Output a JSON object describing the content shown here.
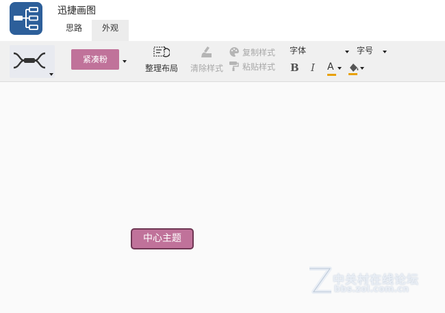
{
  "app": {
    "title": "迅捷画图",
    "logo_icon": "mindmap-logo-icon"
  },
  "tabs": [
    {
      "label": "思路",
      "active": false
    },
    {
      "label": "外观",
      "active": true
    }
  ],
  "toolbar": {
    "layout_icon": "mindmap-structure-icon",
    "theme_label": "紧凑粉",
    "arrange_label": "整理布局",
    "clear_style_label": "清除样式",
    "copy_style_label": "复制样式",
    "paste_style_label": "粘贴样式",
    "font_label": "字体",
    "size_label": "字号",
    "bold_label": "B",
    "italic_label": "I",
    "font_color_label": "A",
    "font_color": "#e8a000",
    "theme_color": "#c0729a"
  },
  "canvas": {
    "central_topic": "中心主题"
  },
  "watermark": {
    "title": "中关村在线论坛",
    "subtitle": "bbs.zol.com.cn"
  }
}
